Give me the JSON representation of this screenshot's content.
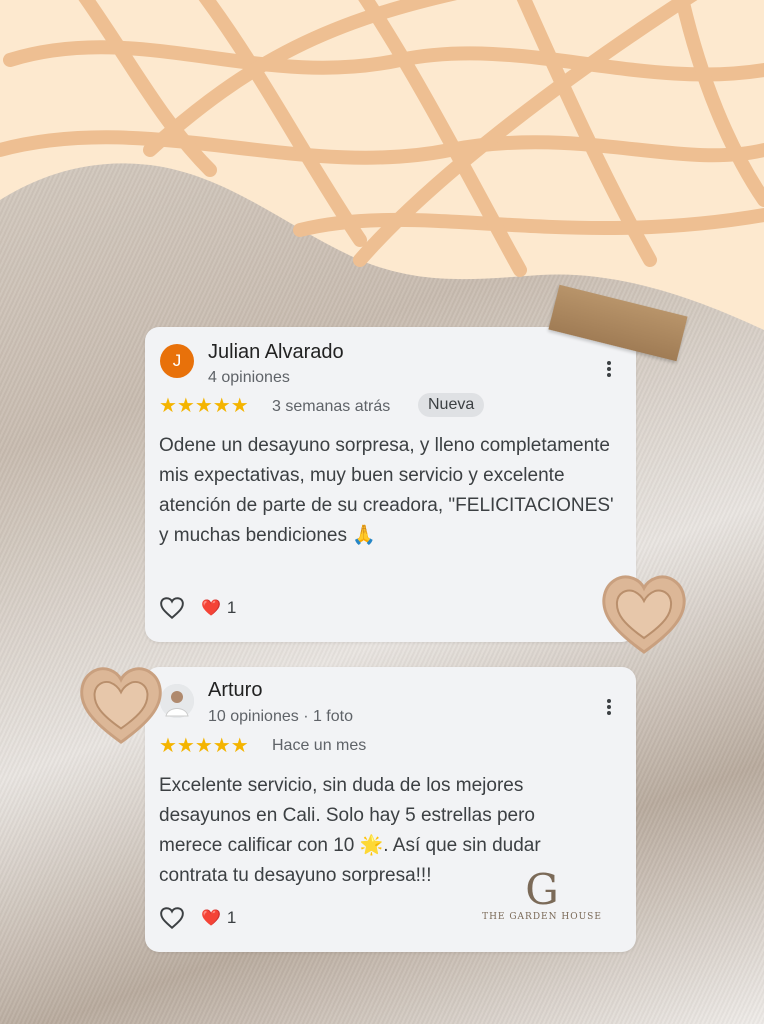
{
  "reviews": [
    {
      "avatar_letter": "J",
      "avatar_color": "#e8710a",
      "name": "Julian Alvarado",
      "meta": "4 opiniones",
      "stars": "★★★★★",
      "when": "3 semanas atrás",
      "badge": "Nueva",
      "text": "Odene un desayuno sorpresa, y lleno completamente mis expectativas, muy buen servicio y excelente atención de parte de su creadora, \"FELICITACIONES' y muchas bendiciones 🙏",
      "heart_emoji": "❤️",
      "heart_count": "1"
    },
    {
      "name": "Arturo",
      "meta": "10 opiniones · 1 foto",
      "stars": "★★★★★",
      "when": "Hace un mes",
      "text": "Excelente servicio, sin duda de los mejores desayunos en Cali. Solo hay 5 estrellas pero merece calificar con 10 🌟. Así que sin dudar contrata tu desayuno sorpresa!!!",
      "heart_emoji": "❤️",
      "heart_count": "1"
    }
  ],
  "logo": {
    "letter": "G",
    "text": "THE GARDEN HOUSE"
  },
  "colors": {
    "star": "#f4b400",
    "card": "#f2f3f5",
    "pattern": "#eebf92",
    "pattern_bg": "#fde9cf"
  }
}
